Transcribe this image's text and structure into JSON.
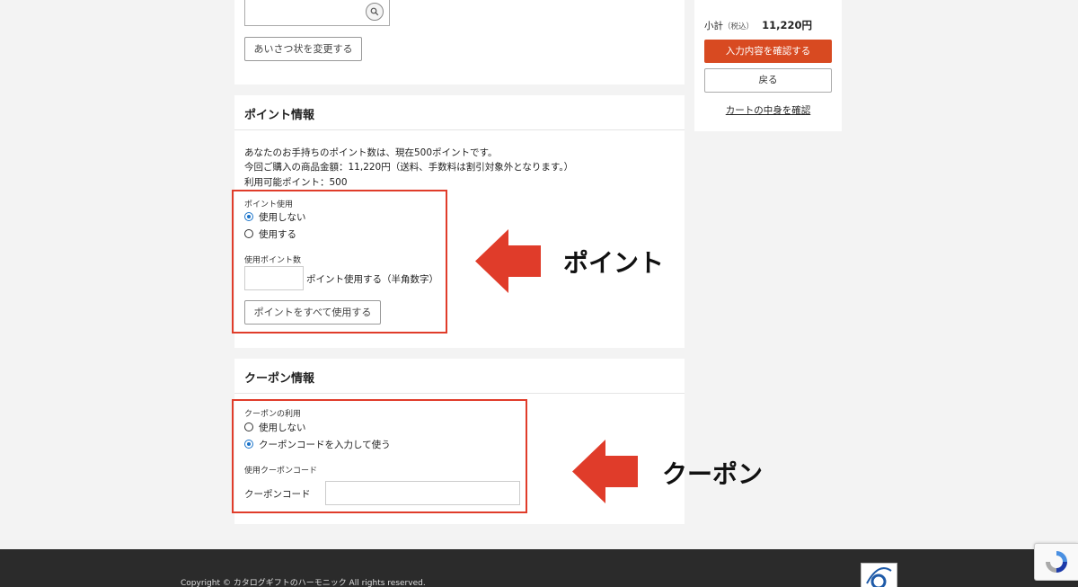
{
  "address": {
    "search_icon": "search-icon",
    "change_greeting_button": "あいさつ状を変更する"
  },
  "points": {
    "title": "ポイント情報",
    "line1": "あなたのお手持ちのポイント数は、現在500ポイントです。",
    "line2": "今回ご購入の商品金額：11,220円（送料、手数料は割引対象外となります。）",
    "line3": "利用可能ポイント：500",
    "usage_label": "ポイント使用",
    "option_no": "使用しない",
    "option_yes": "使用する",
    "selected": "使用しない",
    "amount_label": "使用ポイント数",
    "amount_value": "",
    "amount_suffix": "ポイント使用する（半角数字）",
    "use_all_button": "ポイントをすべて使用する"
  },
  "coupon": {
    "title": "クーポン情報",
    "usage_label": "クーポンの利用",
    "option_no": "使用しない",
    "option_code": "クーポンコードを入力して使う",
    "selected": "クーポンコードを入力して使う",
    "code_section_label": "使用クーポンコード",
    "code_field_label": "クーポンコード",
    "code_value": ""
  },
  "annotations": {
    "point_label": "ポイント",
    "coupon_label": "クーポン",
    "highlight_color": "#e03c2a"
  },
  "summary": {
    "subtotal_label": "小計",
    "tax_note": "（税込）",
    "subtotal_value": "11,220円",
    "confirm_button": "入力内容を確認する",
    "back_button": "戻る",
    "cart_link": "カートの中身を確認",
    "accent_color": "#d84a21"
  },
  "footer": {
    "copyright": "Copyright © カタログギフトのハーモニック All rights reserved."
  }
}
